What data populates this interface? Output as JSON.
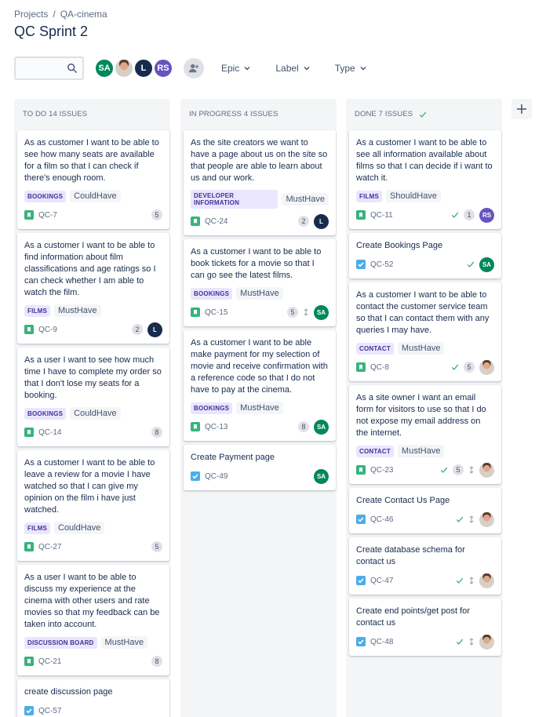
{
  "breadcrumb": {
    "projects": "Projects",
    "separator": "/",
    "project": "QA-cinema"
  },
  "title": "QC Sprint 2",
  "toolbar": {
    "search_placeholder": "",
    "avatars": [
      {
        "initials": "SA",
        "color": "#00875a"
      },
      {
        "initials": "",
        "photo": true
      },
      {
        "initials": "L",
        "color": "#172b4d"
      },
      {
        "initials": "RS",
        "color": "#6554c0"
      }
    ],
    "filters": [
      "Epic",
      "Label",
      "Type"
    ]
  },
  "colors": {
    "story": "#36b37e",
    "task": "#4bade8",
    "done": "#36b37e"
  },
  "columns": [
    {
      "title": "TO DO 14 ISSUES",
      "done_check": false,
      "cards": [
        {
          "title": "As as customer I want to be able to see how many seats are available for a film so that I can check if there's enough room.",
          "epic": "BOOKINGS",
          "label": "CouldHave",
          "type": "story",
          "key": "QC-7",
          "points": "5",
          "check": false,
          "priority": false,
          "avatar": null
        },
        {
          "title": "As a customer I want to be able to find information about film classifications and age ratings so I can check whether I am able to watch the film.",
          "epic": "FILMS",
          "label": "MustHave",
          "type": "story",
          "key": "QC-9",
          "points": "2",
          "check": false,
          "priority": false,
          "avatar": "L"
        },
        {
          "title": "As a user I want to see how much time I have to complete my order so that I don't lose my seats for a booking.",
          "epic": "BOOKINGS",
          "label": "CouldHave",
          "type": "story",
          "key": "QC-14",
          "points": "8",
          "check": false,
          "priority": false,
          "avatar": null
        },
        {
          "title": "As a customer I want to be able to leave a review for a movie I have watched so that I can give my opinion on the film i have just watched.",
          "epic": "FILMS",
          "label": "CouldHave",
          "type": "story",
          "key": "QC-27",
          "points": "5",
          "check": false,
          "priority": false,
          "avatar": null
        },
        {
          "title": "As a user I want to be able to discuss my experience at the cinema with other users and rate movies so that my feedback can be taken into account.",
          "epic": "DISCUSSION BOARD",
          "label": "MustHave",
          "type": "story",
          "key": "QC-21",
          "points": "8",
          "check": false,
          "priority": false,
          "avatar": null
        },
        {
          "title": "create discussion page",
          "epic": "",
          "label": "",
          "type": "task",
          "key": "QC-57",
          "points": "",
          "check": false,
          "priority": false,
          "avatar": null
        }
      ]
    },
    {
      "title": "IN PROGRESS 4 ISSUES",
      "done_check": false,
      "cards": [
        {
          "title": "As the site creators we want to have a page about us on the site so that people are able to learn about us and our work.",
          "epic": "DEVELOPER INFORMATION",
          "label": "MustHave",
          "type": "story",
          "key": "QC-24",
          "points": "2",
          "check": false,
          "priority": false,
          "avatar": "L"
        },
        {
          "title": "As a customer I want to be able to book tickets for a movie so that I can go see the latest films.",
          "epic": "BOOKINGS",
          "label": "MustHave",
          "type": "story",
          "key": "QC-15",
          "points": "5",
          "check": false,
          "priority": true,
          "avatar": "SA"
        },
        {
          "title": "As a customer I want to be able make payment for my selection of movie and receive confirmation with a reference code so that I do not have to pay at the cinema.",
          "epic": "BOOKINGS",
          "label": "MustHave",
          "type": "story",
          "key": "QC-13",
          "points": "8",
          "check": false,
          "priority": false,
          "avatar": "SA"
        },
        {
          "title": "Create Payment page",
          "epic": "",
          "label": "",
          "type": "task",
          "key": "QC-49",
          "points": "",
          "check": false,
          "priority": false,
          "avatar": "SA"
        }
      ]
    },
    {
      "title": "DONE 7 ISSUES",
      "done_check": true,
      "cards": [
        {
          "title": "As a customer I want to be able to see all information available about films so that I can decide if i want to watch it.",
          "epic": "FILMS",
          "label": "ShouldHave",
          "type": "story",
          "key": "QC-11",
          "points": "1",
          "check": true,
          "priority": false,
          "avatar": "RS"
        },
        {
          "title": "Create Bookings Page",
          "epic": "",
          "label": "",
          "type": "task",
          "key": "QC-52",
          "points": "",
          "check": true,
          "priority": false,
          "avatar": "SA"
        },
        {
          "title": "As a customer I want to be able to contact the customer service team so that I can contact them with any queries I may have.",
          "epic": "CONTACT",
          "label": "MustHave",
          "type": "story",
          "key": "QC-8",
          "points": "5",
          "check": true,
          "priority": false,
          "avatar": "photo"
        },
        {
          "title": "As a site owner I want an email form for visitors to use so that I do not expose my email address on the internet.",
          "epic": "CONTACT",
          "label": "MustHave",
          "type": "story",
          "key": "QC-23",
          "points": "5",
          "check": true,
          "priority": true,
          "avatar": "photo"
        },
        {
          "title": "Create Contact Us Page",
          "epic": "",
          "label": "",
          "type": "task",
          "key": "QC-46",
          "points": "",
          "check": true,
          "priority": true,
          "avatar": "photo"
        },
        {
          "title": "Create database schema for contact us",
          "epic": "",
          "label": "",
          "type": "task",
          "key": "QC-47",
          "points": "",
          "check": true,
          "priority": true,
          "avatar": "photo"
        },
        {
          "title": "Create end points/get post for contact us",
          "epic": "",
          "label": "",
          "type": "task",
          "key": "QC-48",
          "points": "",
          "check": true,
          "priority": true,
          "avatar": "photo"
        }
      ]
    }
  ],
  "avatar_colors": {
    "SA": "#00875a",
    "L": "#172b4d",
    "RS": "#6554c0"
  }
}
